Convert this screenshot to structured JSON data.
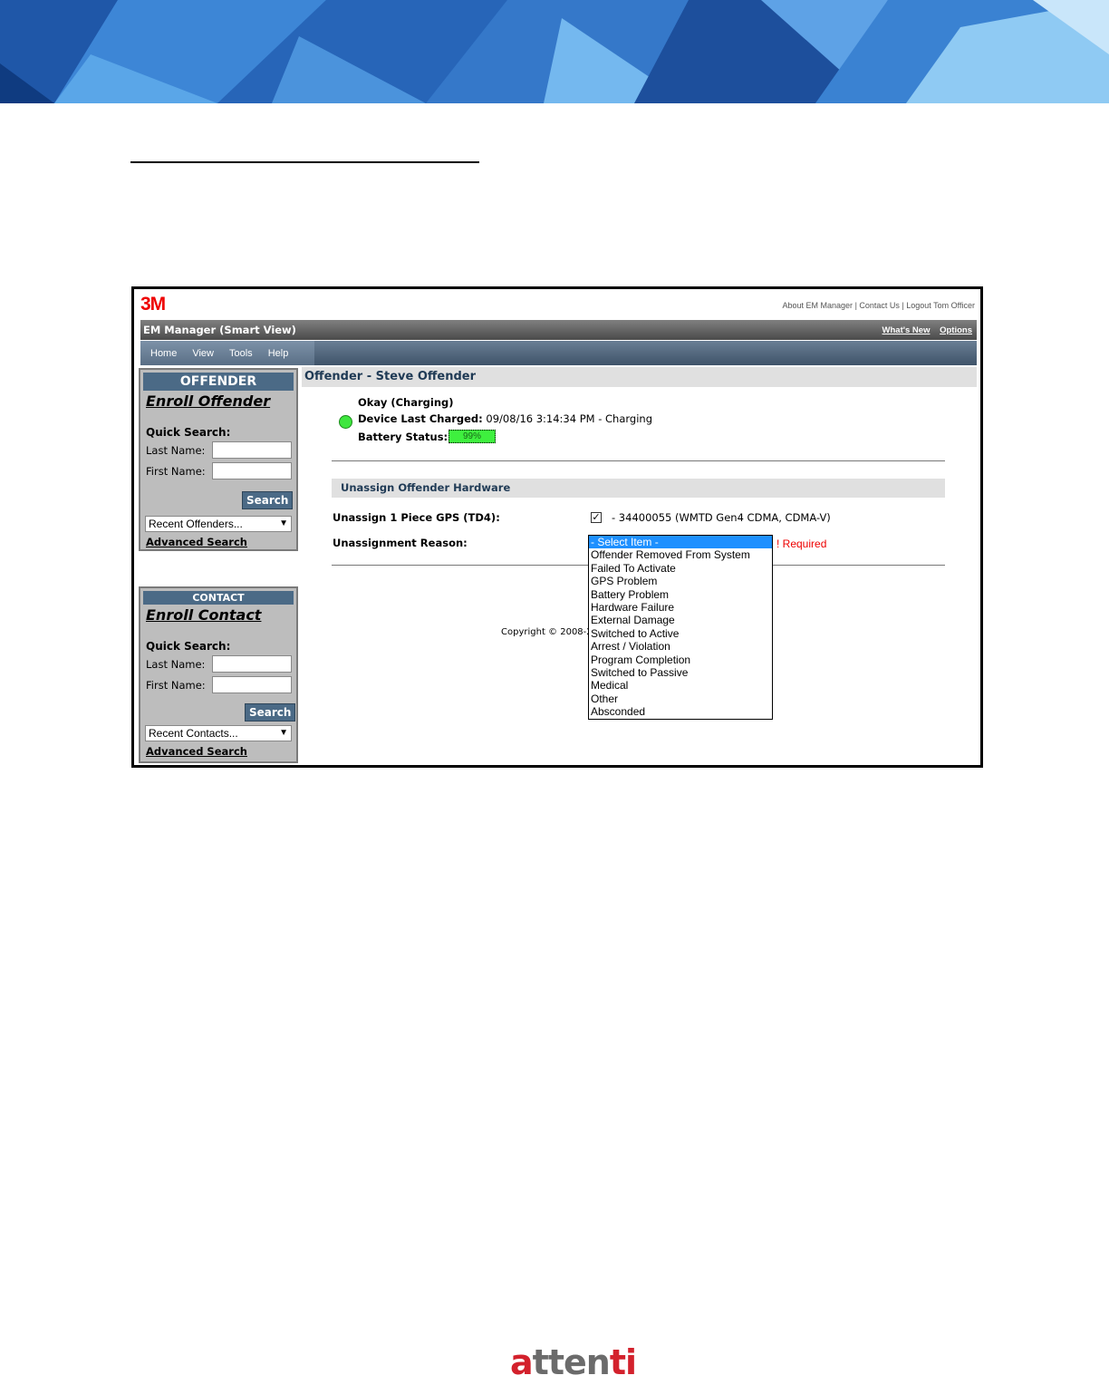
{
  "app": {
    "logo": "3M",
    "top_links": [
      "About EM Manager",
      "Contact Us",
      "Logout Tom Officer"
    ],
    "title": "EM Manager (Smart View)",
    "title_links": [
      "What's New",
      "Options"
    ],
    "menu": [
      "Home",
      "View",
      "Tools",
      "Help"
    ]
  },
  "offender_panel": {
    "header": "OFFENDER",
    "enroll": "Enroll Offender",
    "quick_search": "Quick Search:",
    "last_name_label": "Last Name:",
    "first_name_label": "First Name:",
    "search_button": "Search",
    "recent_select": "Recent Offenders...",
    "advanced_search": "Advanced Search"
  },
  "contact_panel": {
    "header": "CONTACT",
    "enroll": "Enroll Contact",
    "quick_search": "Quick Search:",
    "last_name_label": "Last Name:",
    "first_name_label": "First Name:",
    "search_button": "Search",
    "recent_select": "Recent Contacts...",
    "advanced_search": "Advanced Search"
  },
  "main": {
    "page_title": "Offender - Steve Offender",
    "status": "Okay (Charging)",
    "last_charged_label": "Device Last Charged:",
    "last_charged_value": "09/08/16 3:14:34 PM - Charging",
    "battery_label": "Battery Status:",
    "battery_value": "99%",
    "status_color": "#3ee63e",
    "section_title": "Unassign Offender Hardware",
    "unassign_label": "Unassign 1 Piece GPS (TD4):",
    "unassign_checked": true,
    "device": "- 34400055 (WMTD Gen4 CDMA, CDMA-V)",
    "reason_label": "Unassignment Reason:",
    "required": "! Required",
    "reason_options": [
      "- Select Item -",
      "Offender Removed From System",
      "Failed To Activate",
      "GPS Problem",
      "Battery Problem",
      "Hardware Failure",
      "External Damage",
      "Switched to Active",
      "Arrest / Violation",
      "Program Completion",
      "Switched to Passive",
      "Medical",
      "Other",
      "Absconded"
    ],
    "reason_selected": "- Select Item -",
    "copyright": "Copyright © 2008-2"
  },
  "footer": {
    "brand_a": "a",
    "brand_rest": "tten",
    "brand_end": "ti"
  }
}
